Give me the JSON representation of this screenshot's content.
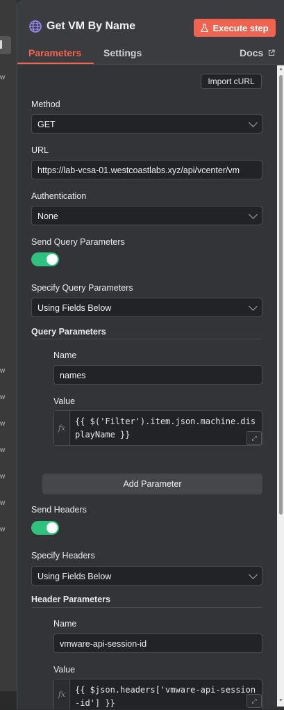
{
  "node": {
    "title": "Get VM By Name",
    "execute_label": "Execute step"
  },
  "tabs": {
    "parameters": "Parameters",
    "settings": "Settings",
    "docs": "Docs"
  },
  "import_curl": "Import cURL",
  "method": {
    "label": "Method",
    "value": "GET"
  },
  "url": {
    "label": "URL",
    "value": "https://lab-vcsa-01.westcoastlabs.xyz/api/vcenter/vm"
  },
  "authentication": {
    "label": "Authentication",
    "value": "None"
  },
  "send_query": {
    "label": "Send Query Parameters",
    "enabled": true
  },
  "specify_query": {
    "label": "Specify Query Parameters",
    "value": "Using Fields Below"
  },
  "query_params": {
    "heading": "Query Parameters",
    "name_label": "Name",
    "name_value": "names",
    "value_label": "Value",
    "value_code": "{{ $('Filter').item.json.machine.displayName }}",
    "add_label": "Add Parameter"
  },
  "send_headers": {
    "label": "Send Headers",
    "enabled": true
  },
  "specify_headers": {
    "label": "Specify Headers",
    "value": "Using Fields Below"
  },
  "header_params": {
    "heading": "Header Parameters",
    "name_label": "Name",
    "name_value": "vmware-api-session-id",
    "value_label": "Value",
    "value_code": "{{ $json.headers['vmware-api-session-id'] }}"
  },
  "fx_label": "fx",
  "colors": {
    "accent": "#ef6450",
    "toggle_on": "#2ec27e",
    "panel_bg": "#333437"
  }
}
